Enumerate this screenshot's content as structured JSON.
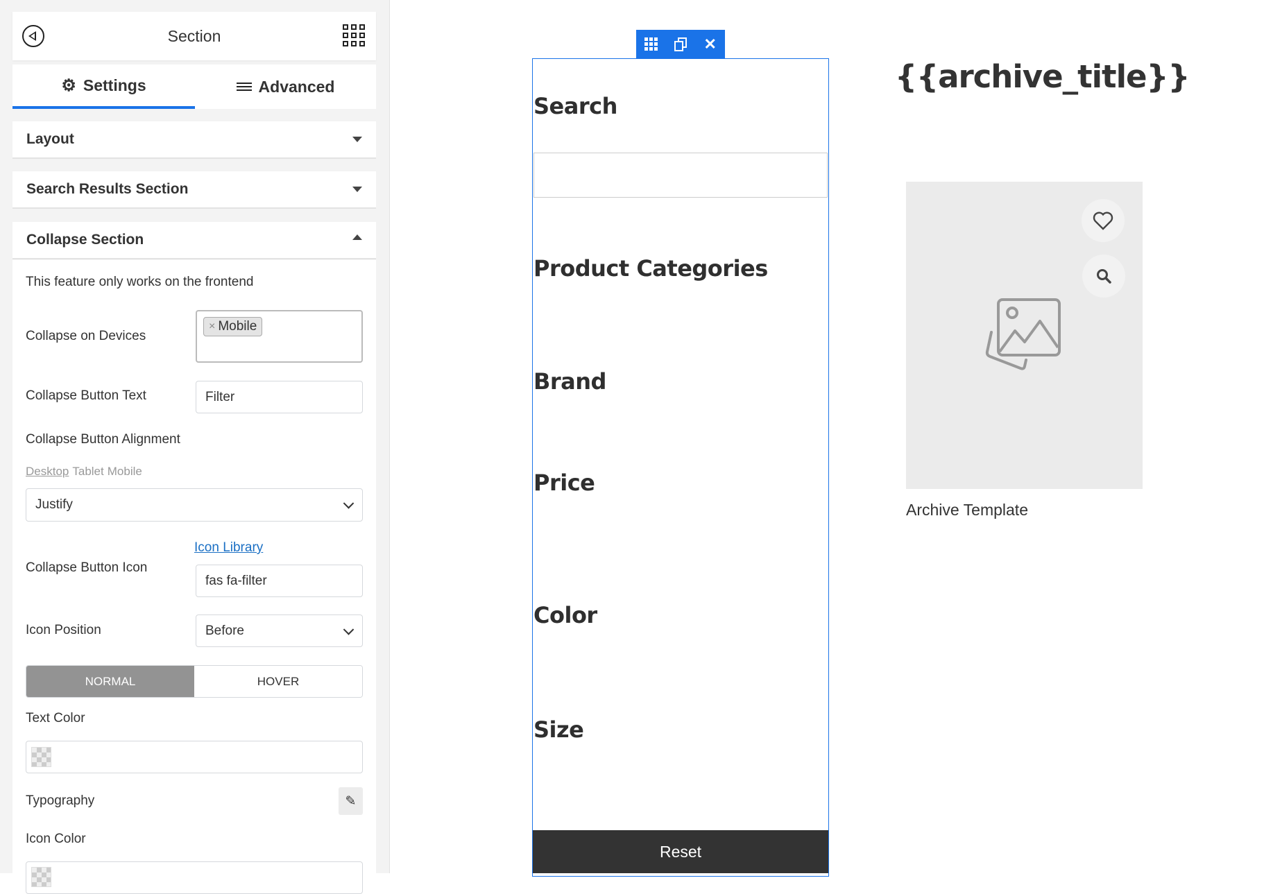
{
  "panel": {
    "header": {
      "title": "Section",
      "back_icon": "back-circle-icon",
      "grid_icon": "grid-icon"
    },
    "tabs": [
      {
        "label": "Settings",
        "icon": "gear-icon",
        "active": true
      },
      {
        "label": "Advanced",
        "icon": "sliders-icon",
        "active": false
      }
    ],
    "sections": [
      {
        "label": "Layout",
        "expanded": false
      },
      {
        "label": "Search Results Section",
        "expanded": false
      },
      {
        "label": "Collapse Section",
        "expanded": true
      }
    ],
    "collapse": {
      "notice": "This feature only works on the frontend",
      "devices_label": "Collapse on Devices",
      "devices_tags": [
        "Mobile"
      ],
      "button_text_label": "Collapse Button Text",
      "button_text_value": "Filter",
      "alignment_label": "Collapse Button Alignment",
      "responsive": [
        "Desktop",
        "Tablet",
        "Mobile"
      ],
      "alignment_value": "Justify",
      "icon_library_link": "Icon Library",
      "icon_label": "Collapse Button Icon",
      "icon_value": "fas fa-filter",
      "icon_position_label": "Icon Position",
      "icon_position_value": "Before",
      "state_tabs": [
        "NORMAL",
        "HOVER"
      ],
      "text_color_label": "Text Color",
      "typography_label": "Typography",
      "icon_color_label": "Icon Color"
    }
  },
  "canvas": {
    "toolbar_icons": [
      "grid-icon",
      "duplicate-icon",
      "close-icon"
    ],
    "accent": "#1a73e8",
    "filters": [
      "Search",
      "Product Categories",
      "Brand",
      "Price",
      "Color",
      "Size"
    ],
    "reset_label": "Reset",
    "archive_title": "{{archive_title}}",
    "product_caption": "Archive Template"
  }
}
